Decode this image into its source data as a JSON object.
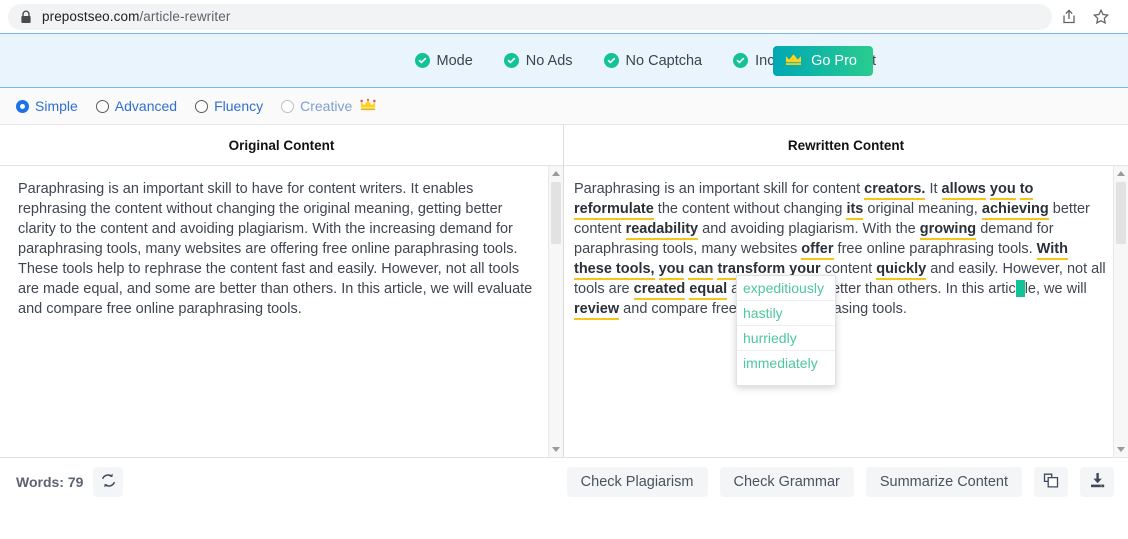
{
  "browser": {
    "url_domain": "prepostseo.com",
    "url_path": "/article-rewriter",
    "lock_icon": "lock-icon",
    "share_icon": "share-icon",
    "bookmark_icon": "star-icon"
  },
  "promo": {
    "items": [
      {
        "label": "Mode",
        "icon": "check-circle-icon"
      },
      {
        "label": "No Ads",
        "icon": "check-circle-icon"
      },
      {
        "label": "No Captcha",
        "icon": "check-circle-icon"
      },
      {
        "label": "Increase word limit",
        "icon": "check-circle-icon"
      }
    ],
    "go_pro_label": "Go Pro",
    "go_pro_icon": "crown-icon",
    "accent_green": "#13c296",
    "banner_bg": "#eaf4fd",
    "banner_border": "#79bbf0"
  },
  "modes": {
    "options": [
      {
        "label": "Simple",
        "selected": true,
        "disabled": false
      },
      {
        "label": "Advanced",
        "selected": false,
        "disabled": false
      },
      {
        "label": "Fluency",
        "selected": false,
        "disabled": false
      },
      {
        "label": "Creative",
        "selected": false,
        "disabled": true,
        "badge_icon": "crown-icon"
      }
    ],
    "selected_color": "#1a73e8",
    "label_color": "#2f6fd0"
  },
  "panels": {
    "original": {
      "title": "Original Content",
      "text": "Paraphrasing is an important skill to have for content writers. It enables rephrasing the content without changing the original meaning, getting better clarity to the content and avoiding plagiarism. With the increasing demand for paraphrasing tools, many websites are offering free online paraphrasing tools. These tools help to rephrase the content fast and easily. However, not all tools are made equal, and some are better than others. In this article, we will evaluate and compare free online paraphrasing tools."
    },
    "rewritten": {
      "title": "Rewritten Content",
      "highlight_underline_color": "#f5c518",
      "segments": [
        {
          "t": "Paraphrasing is an important skill  for content ",
          "m": false
        },
        {
          "t": "creators.",
          "m": true
        },
        {
          "t": " It ",
          "m": false
        },
        {
          "t": "allows",
          "m": true
        },
        {
          "t": " ",
          "m": false
        },
        {
          "t": "you",
          "m": true
        },
        {
          "t": " ",
          "m": false
        },
        {
          "t": "to",
          "m": true
        },
        {
          "t": " ",
          "m": false
        },
        {
          "t": "reformulate",
          "m": true
        },
        {
          "t": " the content without changing ",
          "m": false
        },
        {
          "t": "its",
          "m": true
        },
        {
          "t": " original meaning, ",
          "m": false
        },
        {
          "t": "achieving",
          "m": true
        },
        {
          "t": " better  content ",
          "m": false
        },
        {
          "t": "readability",
          "m": true
        },
        {
          "t": " and avoiding plagiarism. With the ",
          "m": false
        },
        {
          "t": "growing",
          "m": true
        },
        {
          "t": " demand for paraphrasing tools, many websites ",
          "m": false
        },
        {
          "t": "offer",
          "m": true
        },
        {
          "t": " free online paraphrasing tools. ",
          "m": false
        },
        {
          "t": "With these tools,",
          "m": true
        },
        {
          "t": " ",
          "m": false
        },
        {
          "t": "you",
          "m": true
        },
        {
          "t": " ",
          "m": false
        },
        {
          "t": "can",
          "m": true
        },
        {
          "t": " ",
          "m": false
        },
        {
          "t": "transform",
          "m": true
        },
        {
          "t": " ",
          "m": false
        },
        {
          "t": "your",
          "m": true
        },
        {
          "t": " content ",
          "m": false
        },
        {
          "t": "quickly",
          "m": true
        },
        {
          "t": " and easily. However, not all tools are ",
          "m": false
        },
        {
          "t": "created",
          "m": true
        },
        {
          "t": " ",
          "m": false
        },
        {
          "t": "equal",
          "m": true
        },
        {
          "t": " and some are better than ",
          "m": false
        },
        {
          "t": "others. In this artic",
          "m": false,
          "obscured": true
        },
        {
          "t": "le, we will ",
          "m": false
        },
        {
          "t": "review",
          "m": true
        },
        {
          "t": " and compare free online paraphrasing tools.",
          "m": false
        }
      ]
    }
  },
  "synonym_dropdown": {
    "selected_word": "quickly",
    "options": [
      "expeditiously",
      "hastily",
      "hurriedly",
      "immediately"
    ],
    "text_color": "#4ec79a",
    "caret_color": "#13c296"
  },
  "footer": {
    "words_label": "Words: 79",
    "refresh_icon": "refresh-icon",
    "actions": [
      {
        "label": "Check Plagiarism",
        "name": "check-plagiarism-button"
      },
      {
        "label": "Check Grammar",
        "name": "check-grammar-button"
      },
      {
        "label": "Summarize Content",
        "name": "summarize-content-button"
      }
    ],
    "copy_icon": "copy-icon",
    "download_icon": "download-icon"
  }
}
